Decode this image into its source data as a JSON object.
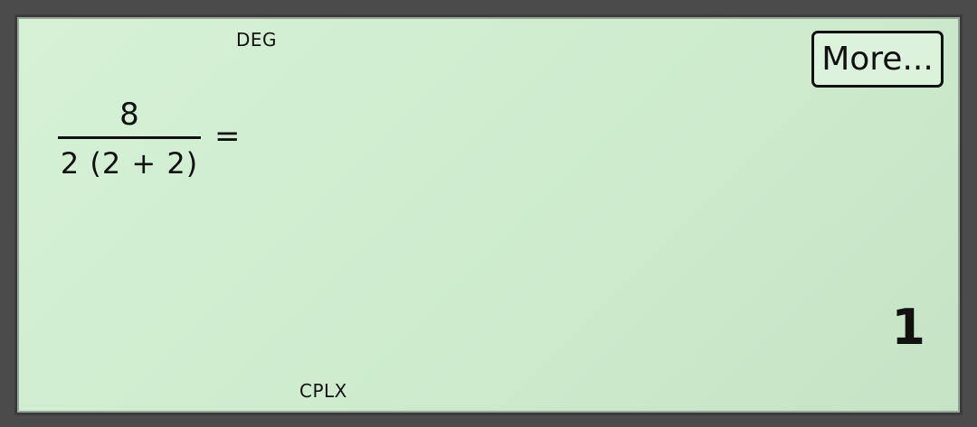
{
  "indicators": {
    "angle_mode": "DEG",
    "complex_mode": "CPLX"
  },
  "toolbar": {
    "more_label": "More..."
  },
  "expression": {
    "numerator": "8",
    "denominator": "2 (2 + 2)",
    "equals": "="
  },
  "result": {
    "value": "1"
  }
}
